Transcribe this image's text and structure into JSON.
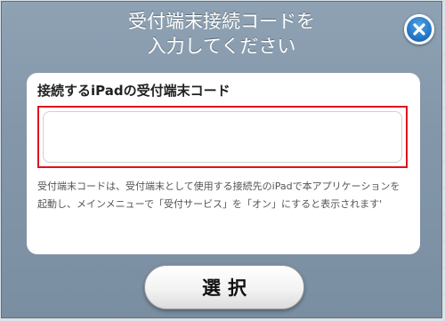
{
  "dialog": {
    "title_line1": "受付端末接続コードを",
    "title_line2": "入力してください"
  },
  "form": {
    "label": "接続するiPadの受付端末コード",
    "code_value": "",
    "help_text": "受付端末コードは、受付端末として使用する接続先のiPadで本アプリケーションを起動し、メインメニューで「受付サービス」を「オン」にすると表示されます'"
  },
  "actions": {
    "select_label": "選択"
  },
  "colors": {
    "panel": "#8497aa",
    "close_button": "#1f6fc1",
    "input_border": "#e0121d"
  }
}
